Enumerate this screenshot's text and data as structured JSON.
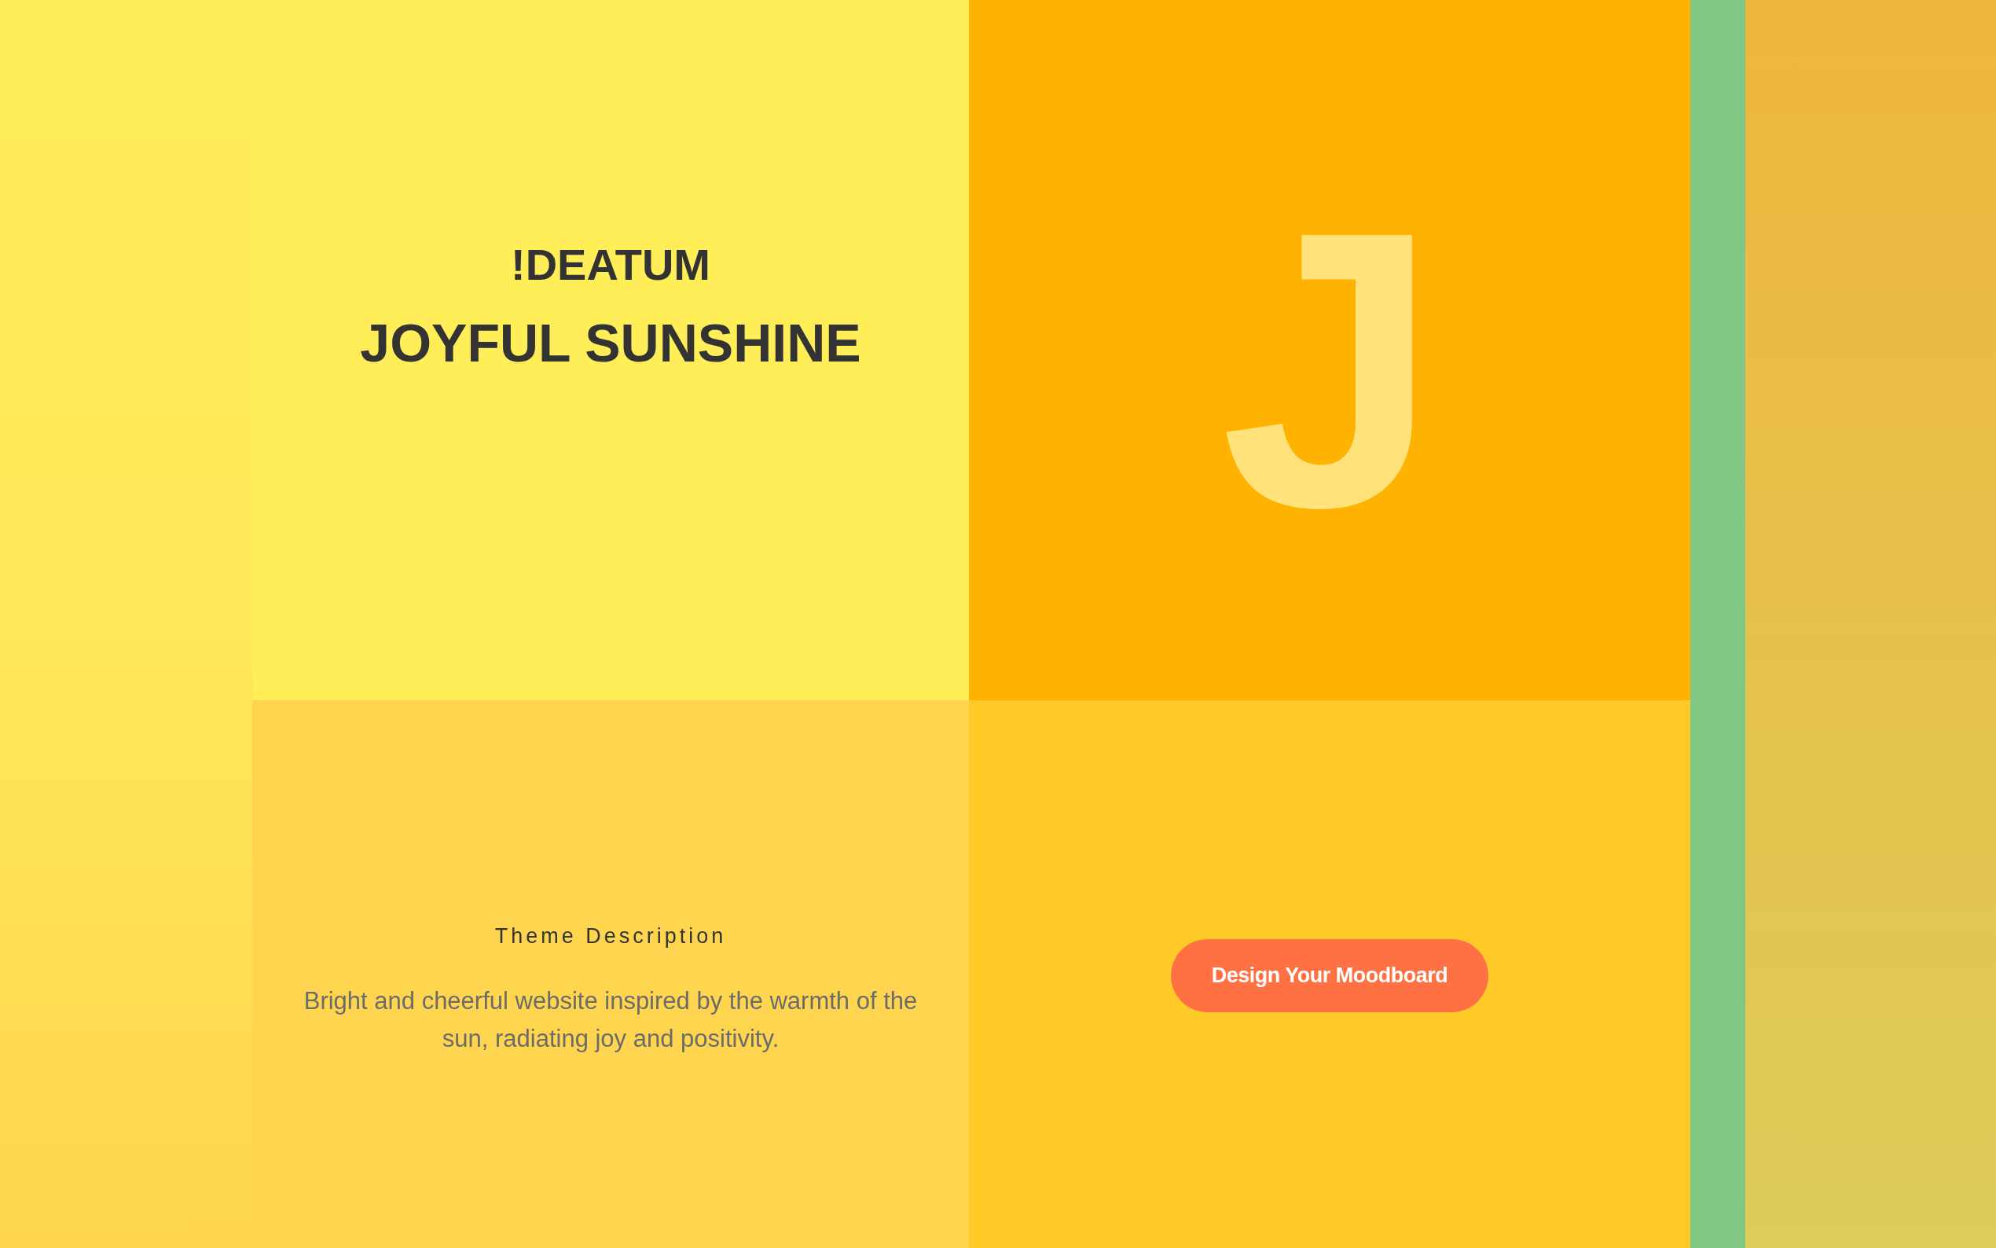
{
  "hero": {
    "brand": "!DEATUM",
    "title": "JOYFUL SUNSHINE"
  },
  "monogram": {
    "letter": "J"
  },
  "description": {
    "heading": "Theme Description",
    "text": "Bright and cheerful website inspired by the warmth of the sun, radiating joy and positivity."
  },
  "cta": {
    "label": "Design Your Moodboard"
  }
}
